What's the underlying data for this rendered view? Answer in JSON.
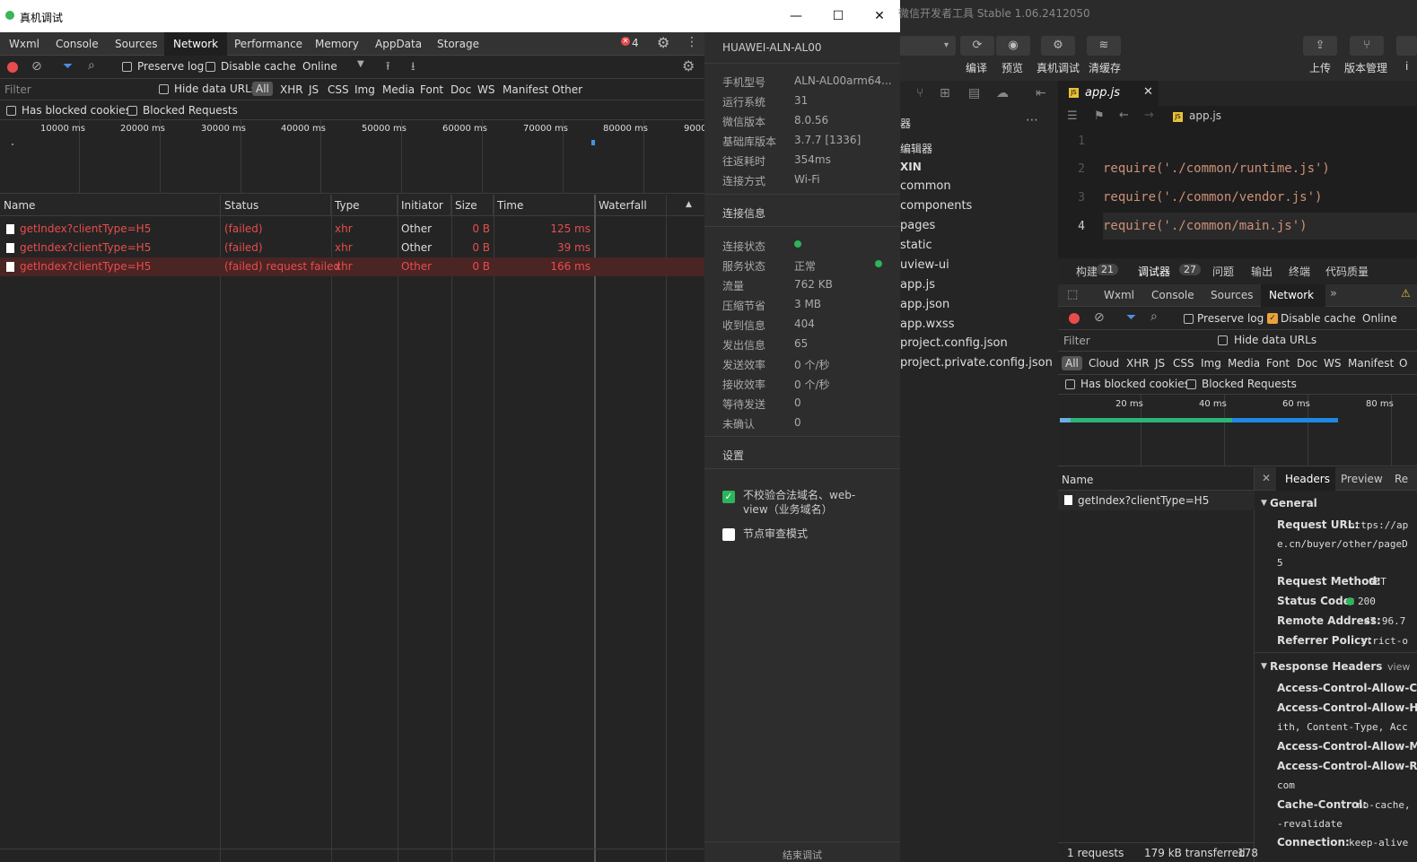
{
  "window": {
    "title": "真机调试",
    "controls": {
      "minimize": "—",
      "maximize": "☐",
      "close": "✕"
    }
  },
  "devtools": {
    "tabs": [
      "Wxml",
      "Console",
      "Sources",
      "Network",
      "Performance",
      "Memory",
      "AppData",
      "Storage"
    ],
    "active_tab": "Network",
    "error_count": "4",
    "toolbar": {
      "preserve_log": "Preserve log",
      "disable_cache": "Disable cache",
      "throttle": "Online"
    },
    "filter": {
      "placeholder": "Filter",
      "hide_data_urls": "Hide data URLs",
      "types": [
        "All",
        "XHR",
        "JS",
        "CSS",
        "Img",
        "Media",
        "Font",
        "Doc",
        "WS",
        "Manifest",
        "Other"
      ],
      "has_blocked_cookies": "Has blocked cookies",
      "blocked_requests": "Blocked Requests"
    },
    "timeline_ticks": [
      "10000 ms",
      "20000 ms",
      "30000 ms",
      "40000 ms",
      "50000 ms",
      "60000 ms",
      "70000 ms",
      "80000 ms",
      "9000"
    ],
    "columns": [
      "Name",
      "Status",
      "Type",
      "Initiator",
      "Size",
      "Time",
      "Waterfall"
    ],
    "requests": [
      {
        "name": "getIndex?clientType=H5",
        "status": "(failed)",
        "type": "xhr",
        "initiator": "Other",
        "size": "0 B",
        "time": "125 ms"
      },
      {
        "name": "getIndex?clientType=H5",
        "status": "(failed)",
        "type": "xhr",
        "initiator": "Other",
        "size": "0 B",
        "time": "39 ms"
      },
      {
        "name": "getIndex?clientType=H5",
        "status": "(failed) request failed",
        "type": "xhr",
        "initiator": "Other",
        "size": "0 B",
        "time": "166 ms"
      }
    ]
  },
  "device": {
    "name": "HUAWEI-ALN-AL00",
    "info": [
      {
        "k": "手机型号",
        "v": "ALN-AL00arm64..."
      },
      {
        "k": "运行系统",
        "v": "31"
      },
      {
        "k": "微信版本",
        "v": "8.0.56"
      },
      {
        "k": "基础库版本",
        "v": "3.7.7 [1336]"
      },
      {
        "k": "往返耗时",
        "v": "354ms"
      },
      {
        "k": "连接方式",
        "v": "Wi-Fi"
      }
    ],
    "conn_title": "连接信息",
    "conn": [
      {
        "k": "连接状态",
        "v": ""
      },
      {
        "k": "服务状态",
        "v": "正常"
      },
      {
        "k": "流量",
        "v": "762 KB"
      },
      {
        "k": "压缩节省",
        "v": "3 MB"
      },
      {
        "k": "收到信息",
        "v": "404"
      },
      {
        "k": "发出信息",
        "v": "65"
      },
      {
        "k": "发送效率",
        "v": "0 个/秒"
      },
      {
        "k": "接收效率",
        "v": "0 个/秒"
      },
      {
        "k": "等待发送",
        "v": "0"
      },
      {
        "k": "未确认",
        "v": "0"
      }
    ],
    "settings_title": "设置",
    "opt_domain": "不校验合法域名、web-view（业务域名）",
    "opt_node": "节点审查模式",
    "bottom_partial": "结束调试"
  },
  "ide": {
    "app_title": "微信开发者工具 Stable 1.06.2412050",
    "toolbar": [
      {
        "label": "编译",
        "icon": "⟳"
      },
      {
        "label": "预览",
        "icon": "◉"
      },
      {
        "label": "真机调试",
        "icon": "⚙"
      },
      {
        "label": "清缓存",
        "icon": "≋"
      }
    ],
    "toolbar_right": [
      {
        "label": "上传",
        "icon": "⇪"
      },
      {
        "label": "版本管理",
        "icon": "⑂"
      },
      {
        "label": "i",
        "icon": ""
      }
    ],
    "explorer_header": "器",
    "explorer_sub": "编辑器",
    "explorer_root": "XIN",
    "files": [
      "common",
      "components",
      "pages",
      "static",
      "uview-ui",
      "app.js",
      "app.json",
      "app.wxss",
      "project.config.json",
      "project.private.config.json"
    ],
    "editor_tab": "app.js",
    "breadcrumb": "app.js",
    "code_lines": [
      {
        "n": "1",
        "text": ""
      },
      {
        "n": "2",
        "text": "require('./common/runtime.js')"
      },
      {
        "n": "3",
        "text": "require('./common/vendor.js')"
      },
      {
        "n": "4",
        "text": "require('./common/main.js')"
      }
    ],
    "debug_tabs": [
      {
        "label": "构建",
        "badge": "21"
      },
      {
        "label": "调试器",
        "badge": "27"
      },
      {
        "label": "问题",
        "badge": ""
      },
      {
        "label": "输出",
        "badge": ""
      },
      {
        "label": "终端",
        "badge": ""
      },
      {
        "label": "代码质量",
        "badge": ""
      }
    ],
    "dev_tabs": [
      "Wxml",
      "Console",
      "Sources",
      "Network"
    ],
    "preserve_log": "Preserve log",
    "disable_cache": "Disable cache",
    "throttle": "Online",
    "filter": "Filter",
    "hide_data_urls": "Hide data URLs",
    "types": [
      "All",
      "Cloud",
      "XHR",
      "JS",
      "CSS",
      "Img",
      "Media",
      "Font",
      "Doc",
      "WS",
      "Manifest",
      "O"
    ],
    "has_blocked_cookies": "Has blocked cookies",
    "blocked_requests": "Blocked Requests",
    "ticks": [
      "20 ms",
      "40 ms",
      "60 ms",
      "80 ms"
    ],
    "name_col": "Name",
    "request": "getIndex?clientType=H5",
    "detail_tabs": [
      "Headers",
      "Preview",
      "Re"
    ],
    "general_title": "General",
    "general": [
      {
        "k": "Request URL:",
        "v": "https://ap"
      },
      {
        "k": "",
        "v": "e.cn/buyer/other/pageD"
      },
      {
        "k": "",
        "v": "5"
      },
      {
        "k": "Request Method:",
        "v": "GET"
      },
      {
        "k": "Status Code:",
        "v": "200"
      },
      {
        "k": "Remote Address:",
        "v": "47.96.7"
      },
      {
        "k": "Referrer Policy:",
        "v": "strict-o"
      }
    ],
    "response_title": "Response Headers",
    "response_view": "view",
    "response": [
      {
        "k": "Access-Control-Allow-Cre",
        "v": ""
      },
      {
        "k": "Access-Control-Allow-Hea",
        "v": ""
      },
      {
        "k": "",
        "v": "ith, Content-Type, Acc"
      },
      {
        "k": "Access-Control-Allow-Me",
        "v": ""
      },
      {
        "k": "Access-Control-Allow-Ref",
        "v": ""
      },
      {
        "k": "",
        "v": "com"
      },
      {
        "k": "Cache-Control:",
        "v": "no-cache,"
      },
      {
        "k": "",
        "v": "-revalidate"
      },
      {
        "k": "Connection:",
        "v": "keep-alive"
      }
    ],
    "status_bar": [
      "1 requests",
      "179 kB transferred",
      "178"
    ]
  },
  "colors": {
    "error": "#e94c4c",
    "ok": "#2cb55a",
    "accent": "#1e88e5"
  }
}
